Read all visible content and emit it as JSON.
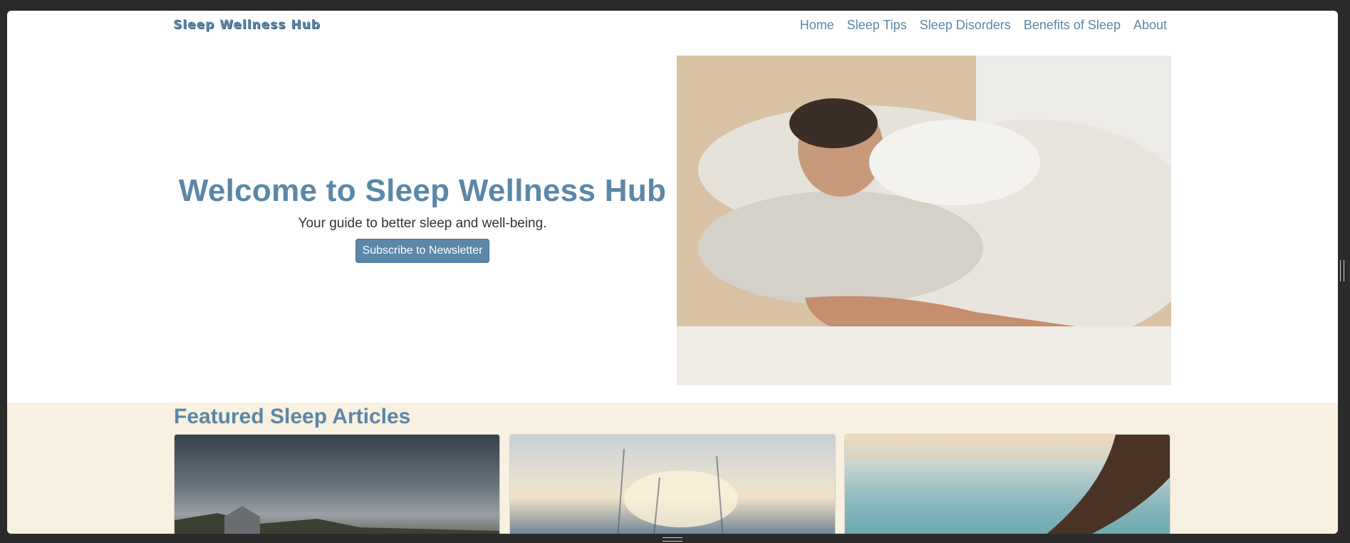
{
  "site": {
    "brand": "Sleep Wellness Hub"
  },
  "nav": {
    "links": [
      "Home",
      "Sleep Tips",
      "Sleep Disorders",
      "Benefits of Sleep",
      "About"
    ]
  },
  "hero": {
    "title": "Welcome to Sleep Wellness Hub",
    "subtitle": "Your guide to better sleep and well-being.",
    "button_label": "Subscribe to Newsletter"
  },
  "featured": {
    "title": "Featured Sleep Articles"
  },
  "colors": {
    "accent": "#5b87a8",
    "featured_bg": "#f8f0e0"
  }
}
